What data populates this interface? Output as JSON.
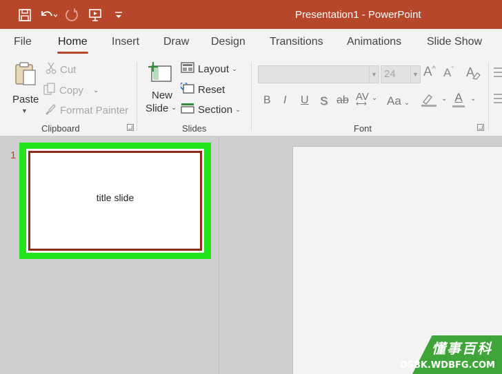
{
  "window": {
    "title": "Presentation1 - PowerPoint"
  },
  "colors": {
    "accent": "#b7472a",
    "highlight": "#22e51e",
    "slide_border": "#8e2a17"
  },
  "quick_access": [
    {
      "name": "save-icon"
    },
    {
      "name": "undo-icon"
    },
    {
      "name": "redo-icon"
    },
    {
      "name": "present-icon"
    },
    {
      "name": "customize-icon"
    }
  ],
  "tabs": [
    {
      "label": "File"
    },
    {
      "label": "Home",
      "active": true
    },
    {
      "label": "Insert"
    },
    {
      "label": "Draw"
    },
    {
      "label": "Design"
    },
    {
      "label": "Transitions"
    },
    {
      "label": "Animations"
    },
    {
      "label": "Slide Show"
    }
  ],
  "ribbon": {
    "clipboard": {
      "paste": "Paste",
      "cut": "Cut",
      "copy": "Copy",
      "format_painter": "Format Painter",
      "label": "Clipboard"
    },
    "slides": {
      "new_slide_line1": "New",
      "new_slide_line2": "Slide",
      "layout": "Layout",
      "reset": "Reset",
      "section": "Section",
      "label": "Slides"
    },
    "font": {
      "name_value": "",
      "size_value": "24",
      "grow": "A",
      "shrink": "A",
      "bold": "B",
      "italic": "I",
      "underline": "U",
      "shadow": "S",
      "strike": "ab",
      "spacing": "AV",
      "case": "Aa",
      "color": "A",
      "label": "Font"
    }
  },
  "slides_panel": {
    "slide_number": "1",
    "thumbnail_title": "title slide"
  },
  "watermark": {
    "cn": "懂事百科",
    "en": "DSBK.WDBFG.COM"
  }
}
